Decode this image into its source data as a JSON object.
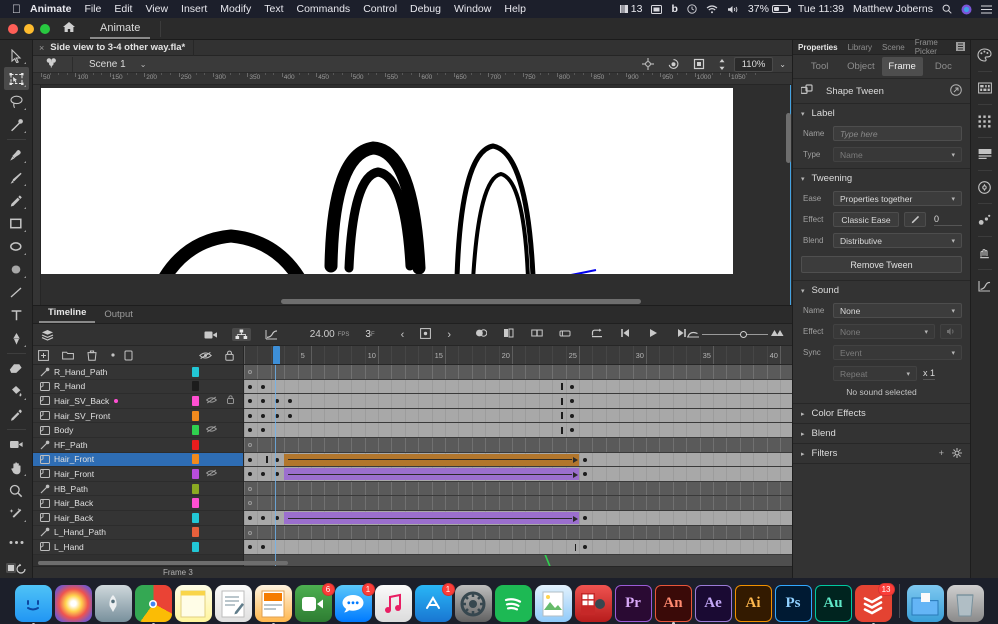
{
  "macbar": {
    "apple": "",
    "menus": [
      "Animate",
      "File",
      "Edit",
      "View",
      "Insert",
      "Modify",
      "Text",
      "Commands",
      "Control",
      "Debug",
      "Window",
      "Help"
    ],
    "right": {
      "count": "13",
      "screen_icon": "screen-mirroring-icon",
      "dropbox": "b",
      "clock_icon": "time-machine-icon",
      "wifi": "wifi-icon",
      "volume": "volume-icon",
      "battery_pct": "37%",
      "datetime": "Tue 11:39",
      "user": "Matthew Joberns",
      "search": "search-icon",
      "siri": "siri-icon",
      "control": "control-center-icon"
    }
  },
  "window": {
    "home_label": "home-icon",
    "app_tab": "Animate"
  },
  "document": {
    "tab_close": "×",
    "tab_name": "Side view to 3-4 other way.fla*"
  },
  "scenebar": {
    "edit_symbols_icon": "scene-clover-icon",
    "scene_name": "Scene 1",
    "chevron": "⌄",
    "center_icon": "center-stage-icon",
    "rotate_icon": "rotate-icon",
    "clip_icon": "clip-content-icon",
    "stepper_icon": "stepper-icon",
    "zoom_value": "110%",
    "zoom_chevron": "⌄"
  },
  "tools": [
    {
      "name": "selection-tool",
      "selected": false
    },
    {
      "name": "free-transform-tool",
      "selected": true
    },
    {
      "name": "lasso-tool",
      "selected": false
    },
    {
      "name": "bone-tool",
      "selected": false
    },
    {
      "name": "paint-brush-tool",
      "selected": false
    },
    {
      "name": "brush-tool",
      "selected": false
    },
    {
      "name": "pencil-tool",
      "selected": false
    },
    {
      "name": "rectangle-tool",
      "selected": false
    },
    {
      "name": "oval-tool",
      "selected": false
    },
    {
      "name": "fill-tool",
      "selected": false
    },
    {
      "name": "line-tool",
      "selected": false
    },
    {
      "name": "text-tool",
      "selected": false
    },
    {
      "name": "pen-tool",
      "selected": false
    },
    {
      "name": "eraser-tool",
      "selected": false
    },
    {
      "name": "paint-bucket-tool",
      "selected": false
    },
    {
      "name": "eyedropper-tool",
      "selected": false
    },
    {
      "name": "camera-tool",
      "selected": false
    },
    {
      "name": "hand-tool",
      "selected": false
    },
    {
      "name": "zoom-tool",
      "selected": false
    },
    {
      "name": "magic-wand-tool",
      "selected": false
    },
    {
      "name": "more-tools",
      "selected": false
    }
  ],
  "stage": {
    "ruler_marks": [
      "50",
      "100",
      "150",
      "200",
      "250",
      "300",
      "350",
      "400",
      "450",
      "500",
      "550",
      "600",
      "650",
      "700",
      "750",
      "800",
      "850",
      "900",
      "950",
      "1000",
      "1050"
    ],
    "paper_color": "#ffffff",
    "guide_color": "#0000ee",
    "stroke_color": "#000000"
  },
  "timeline": {
    "tabs": [
      {
        "label": "Timeline",
        "active": true
      },
      {
        "label": "Output",
        "active": false
      }
    ],
    "layers_icon": "layer-stack-icon",
    "camera_icon": "camera-icon",
    "parent_icon": "parent-view-icon",
    "graph_icon": "motion-editor-icon",
    "fps": "24.00",
    "fps_unit": "FPS",
    "current_frame": "3",
    "frame_unit": "F",
    "nav_prev": "‹",
    "nav_keyframe": "keyframe-marker-icon",
    "nav_next": "›",
    "onion_icons": [
      "onion-skin-icon",
      "onion-outline-icon",
      "edit-multiple-frames-icon",
      "modify-markers-icon"
    ],
    "playback": [
      "loop-icon",
      "step-back-icon",
      "play-icon",
      "step-forward-icon"
    ],
    "resize_icon": "resize-timeline-icon",
    "zoom_slider_icon": "frame-zoom-icon",
    "layer_header_icons": [
      "new-layer-icon",
      "new-folder-icon",
      "delete-layer-icon",
      "dot-icon",
      "camera-attach-icon",
      "hide-all-icon",
      "lock-all-icon"
    ],
    "ruler_numbers": [
      "5",
      "10",
      "15",
      "20",
      "25",
      "30",
      "35",
      "40"
    ],
    "status_label": "Frame 3",
    "layers": [
      {
        "name": "R_Hand_Path",
        "type": "path-layer",
        "chip": "#22c7d6",
        "hidden": false,
        "locked": false,
        "selected": false,
        "marker": false
      },
      {
        "name": "R_Hand",
        "type": "normal-layer",
        "chip": "#1c1c1c",
        "hidden": false,
        "locked": false,
        "selected": false,
        "marker": false
      },
      {
        "name": "Hair_SV_Back",
        "type": "normal-layer",
        "chip": "#ff4fd2",
        "hidden": true,
        "locked": true,
        "selected": false,
        "marker": true
      },
      {
        "name": "Hair_SV_Front",
        "type": "normal-layer",
        "chip": "#f08a1e",
        "hidden": false,
        "locked": false,
        "selected": false,
        "marker": false
      },
      {
        "name": "Body",
        "type": "normal-layer",
        "chip": "#2fd14f",
        "hidden": true,
        "locked": false,
        "selected": false,
        "marker": false
      },
      {
        "name": "HF_Path",
        "type": "path-layer",
        "chip": "#e81d1d",
        "hidden": false,
        "locked": false,
        "selected": false,
        "marker": false
      },
      {
        "name": "Hair_Front",
        "type": "normal-layer",
        "chip": "#f08a1e",
        "hidden": false,
        "locked": false,
        "selected": true,
        "marker": false
      },
      {
        "name": "Hair_Front",
        "type": "normal-layer",
        "chip": "#b84ddb",
        "hidden": true,
        "locked": false,
        "selected": false,
        "marker": false
      },
      {
        "name": "HB_Path",
        "type": "path-layer",
        "chip": "#8aaa22",
        "hidden": false,
        "locked": false,
        "selected": false,
        "marker": false
      },
      {
        "name": "Hair_Back",
        "type": "normal-layer",
        "chip": "#ff4fd2",
        "hidden": false,
        "locked": false,
        "selected": false,
        "marker": false
      },
      {
        "name": "Hair_Back",
        "type": "normal-layer",
        "chip": "#22c7d6",
        "hidden": false,
        "locked": false,
        "selected": false,
        "marker": false
      },
      {
        "name": "L_Hand_Path",
        "type": "path-layer",
        "chip": "#e8603c",
        "hidden": false,
        "locked": false,
        "selected": false,
        "marker": false
      },
      {
        "name": "L_Hand",
        "type": "normal-layer",
        "chip": "#22c7d6",
        "hidden": false,
        "locked": false,
        "selected": false,
        "marker": false
      }
    ]
  },
  "properties": {
    "panel_tabs": [
      {
        "label": "Properties",
        "active": true
      },
      {
        "label": "Library",
        "active": false
      },
      {
        "label": "Scene",
        "active": false
      },
      {
        "label": "Frame Picker",
        "active": false
      }
    ],
    "menu_icon": "panel-menu-icon",
    "segments": [
      {
        "label": "Tool",
        "active": false
      },
      {
        "label": "Object",
        "active": false
      },
      {
        "label": "Frame",
        "active": true
      },
      {
        "label": "Doc",
        "active": false
      }
    ],
    "tween_type": {
      "icon": "shape-tween-icon",
      "title": "Shape Tween",
      "goto_icon": "goto-icon"
    },
    "label": {
      "title": "Label",
      "name_label": "Name",
      "name_placeholder": "Type here",
      "name_value": "",
      "type_label": "Type",
      "type_value": "Name"
    },
    "tweening": {
      "title": "Tweening",
      "ease_label": "Ease",
      "ease_value": "Properties together",
      "effect_label": "Effect",
      "effect_value": "Classic Ease",
      "effect_edit_icon": "edit-ease-icon",
      "effect_number": "0",
      "blend_label": "Blend",
      "blend_value": "Distributive",
      "remove_button": "Remove Tween"
    },
    "sound": {
      "title": "Sound",
      "name_label": "Name",
      "name_value": "None",
      "effect_label": "Effect",
      "effect_value": "None",
      "effect_icon": "sound-edit-icon",
      "sync_label": "Sync",
      "sync_value": "Event",
      "repeat_value": "Repeat",
      "repeat_count": "x 1",
      "status": "No sound selected"
    },
    "collapsed": [
      {
        "title": "Color Effects",
        "actions": []
      },
      {
        "title": "Blend",
        "actions": []
      },
      {
        "title": "Filters",
        "actions": [
          "add-filter-icon",
          "filter-options-icon"
        ]
      }
    ]
  },
  "right_rail": [
    "color-palette-icon",
    "library-panel-icon",
    "align-panel-icon",
    "info-panel-icon",
    "transform-panel-icon",
    "components-panel-icon",
    "actions-panel-icon",
    "motion-editor-panel-icon"
  ],
  "dock": [
    {
      "name": "finder",
      "label": "",
      "badge": "",
      "running": true
    },
    {
      "name": "photos",
      "label": "",
      "badge": "",
      "running": false
    },
    {
      "name": "launchpad",
      "label": "",
      "badge": "",
      "running": false
    },
    {
      "name": "chrome",
      "label": "",
      "badge": "",
      "running": true
    },
    {
      "name": "notes",
      "label": "",
      "badge": "",
      "running": false
    },
    {
      "name": "pages",
      "label": "",
      "badge": "",
      "running": false
    },
    {
      "name": "keynote",
      "label": "",
      "badge": "",
      "running": true
    },
    {
      "name": "facetime",
      "label": "",
      "badge": "6",
      "running": false
    },
    {
      "name": "messages",
      "label": "",
      "badge": "1",
      "running": false
    },
    {
      "name": "itunes",
      "label": "",
      "badge": "",
      "running": false
    },
    {
      "name": "app-store",
      "label": "",
      "badge": "1",
      "running": false
    },
    {
      "name": "system-preferences",
      "label": "",
      "badge": "",
      "running": false
    },
    {
      "name": "spotify",
      "label": "",
      "badge": "",
      "running": false
    },
    {
      "name": "preview",
      "label": "",
      "badge": "",
      "running": false
    },
    {
      "name": "photo-booth",
      "label": "",
      "badge": "",
      "running": false
    },
    {
      "name": "premiere-pro",
      "label": "Pr",
      "badge": "",
      "running": false
    },
    {
      "name": "animate",
      "label": "An",
      "badge": "",
      "running": true
    },
    {
      "name": "after-effects",
      "label": "Ae",
      "badge": "",
      "running": false
    },
    {
      "name": "illustrator",
      "label": "Ai",
      "badge": "",
      "running": false
    },
    {
      "name": "photoshop",
      "label": "Ps",
      "badge": "",
      "running": false
    },
    {
      "name": "audition",
      "label": "Au",
      "badge": "",
      "running": false
    },
    {
      "name": "todoist",
      "label": "",
      "badge": "13",
      "running": true
    },
    {
      "name": "downloads-folder",
      "label": "",
      "badge": "",
      "running": false
    },
    {
      "name": "trash",
      "label": "",
      "badge": "",
      "running": false
    }
  ]
}
